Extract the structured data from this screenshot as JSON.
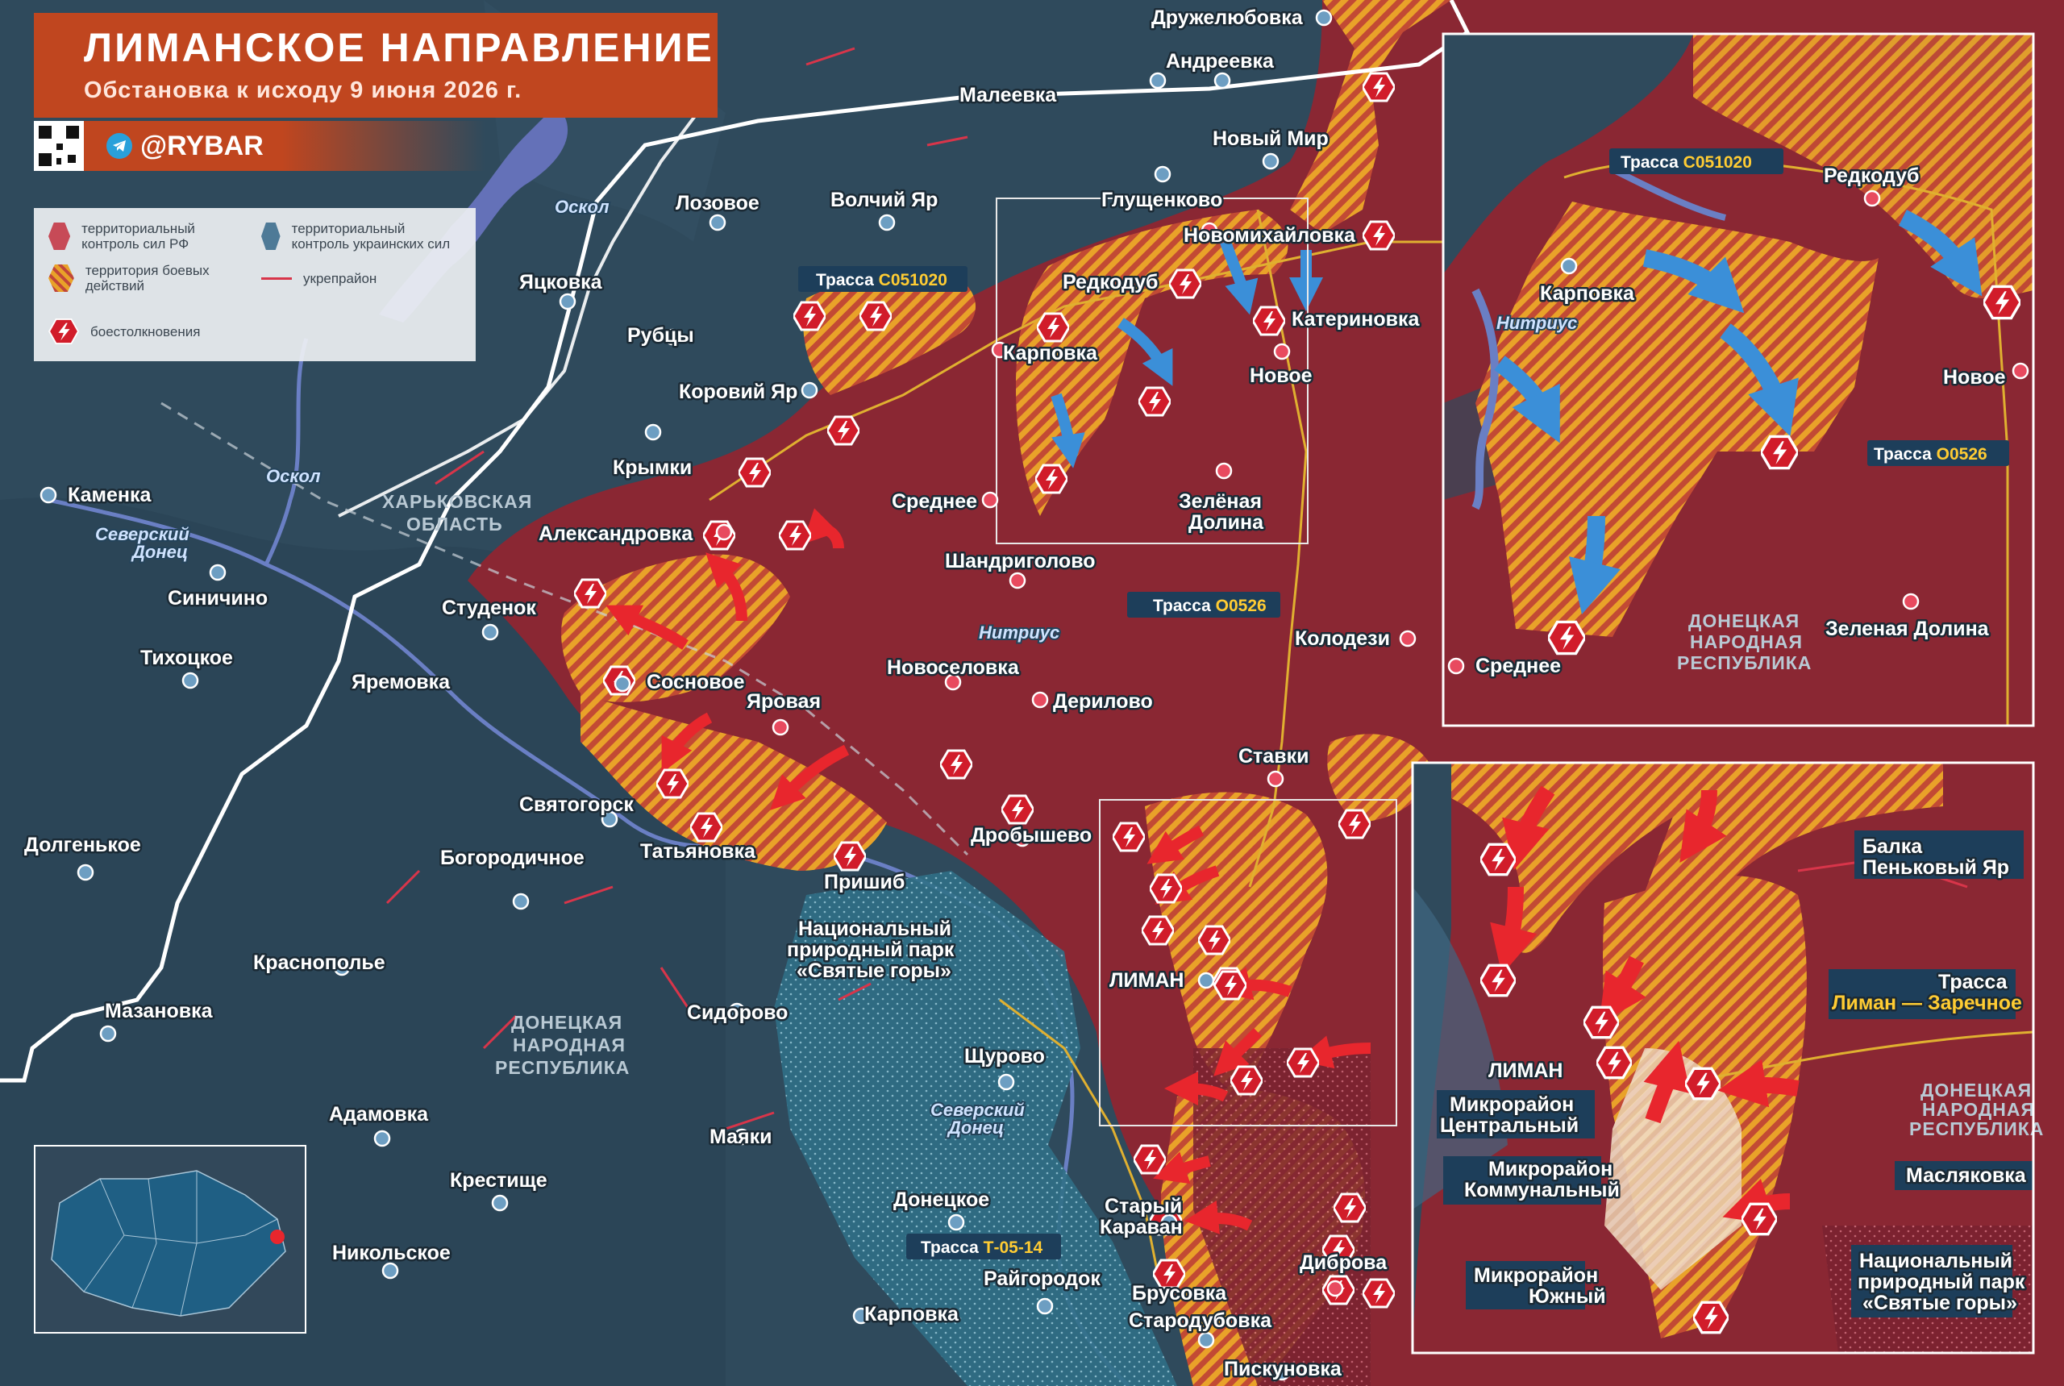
{
  "header": {
    "title": "ЛИМАНСКОЕ НАПРАВЛЕНИЕ",
    "subtitle": "Обстановка к исходу 9 июня 2026 г."
  },
  "brand": {
    "handle": "@RYBAR",
    "icon": "telegram-icon"
  },
  "legend": {
    "ru_control": "территориальный контроль сил РФ",
    "ua_control": "территориальный контроль украинских сил",
    "fighting": "территория боевых действий",
    "fortified": "укрепрайон",
    "clashes": "боестолкновения"
  },
  "colors": {
    "ru": "#8a2733",
    "ua": "#2e4a5c",
    "fight_orange": "#e9a229",
    "clash": "#d11c2a",
    "header": "#c0461f",
    "road_tag": "#1d3e5a",
    "road_code": "#ffcc33"
  },
  "regions": {
    "kharkiv": [
      "ХАРЬКОВСКАЯ",
      "ОБЛАСТЬ"
    ],
    "dnr": [
      "ДОНЕЦКАЯ",
      "НАРОДНАЯ",
      "РЕСПУБЛИКА"
    ]
  },
  "rivers": {
    "oskol1": "Оскол",
    "oskol2": "Оскол",
    "donets1": [
      "Северский",
      "Донец"
    ],
    "donets2": [
      "Северский",
      "Донец"
    ],
    "nitrius": "Нитриус"
  },
  "roads": {
    "r1": {
      "prefix": "Трасса ",
      "code": "С051020"
    },
    "r2": {
      "prefix": "Трасса ",
      "code": "О0526"
    },
    "r3": {
      "prefix": "Трасса ",
      "code": "Т-05-14"
    }
  },
  "places": {
    "druzhelyubovka": "Дружелюбовка",
    "andreevka": "Андреевка",
    "maleevka": "Малеевка",
    "novy_mir": "Новый Мир",
    "lozovoe": "Лозовое",
    "volchiy_yar": "Волчий Яр",
    "glushchenkovo": "Глущенково",
    "novomikhaylovka": "Новомихайловка",
    "yatskovka": "Яцковка",
    "rubtsy": "Рубцы",
    "redkodub": "Редкодуб",
    "katerinovka": "Катериновка",
    "karpovka": "Карповка",
    "novoe": "Новое",
    "koroviy_yar": "Коровий Яр",
    "krymki": "Крымки",
    "srednee": "Среднее",
    "zelenaya_dolina": [
      "Зелёная",
      "Долина"
    ],
    "kamenka": "Каменка",
    "aleksandrovka": "Александровка",
    "shandrigolovo": "Шандриголово",
    "sinichino": "Синичино",
    "studenok": "Студенок",
    "kolodezi": "Колодези",
    "tikhotskoe": "Тихоцкое",
    "yaremovka": "Яремовка",
    "novoselovka": "Новоселовка",
    "sosnovoe": "Сосновое",
    "yarovaya": "Яровая",
    "derilovo": "Дерилово",
    "stavki": "Ставки",
    "svyatogorsk": "Святогорск",
    "dolgenkoe": "Долгенькое",
    "bogorodichnoe": "Богородичное",
    "tatyanovka": "Татьяновка",
    "drobyshevo": "Дробышево",
    "prishib": "Пришиб",
    "park": [
      "Национальный",
      "природный парк",
      "«Святые горы»"
    ],
    "liman": "ЛИМАН",
    "krasnopolye": "Краснополье",
    "mazanovka": "Мазановка",
    "sidorovo": "Сидорово",
    "shchurovo": "Щурово",
    "adamovka": "Адамовка",
    "mayaki": "Маяки",
    "krestishche": "Крестище",
    "donetskoe": "Донецкое",
    "stary_karavan": [
      "Старый",
      "Караван"
    ],
    "nikolskoe": "Никольское",
    "raygorodok": "Райгородок",
    "brusovka": "Брусовка",
    "dibrova": "Диброва",
    "karpovka2": "Карповка",
    "starodubovka": "Стародубовка",
    "piskunovka": "Пискуновка"
  },
  "inset_top": {
    "road1": {
      "prefix": "Трасса ",
      "code": "С051020"
    },
    "road2": {
      "prefix": "Трасса ",
      "code": "О0526"
    },
    "redkodub": "Редкодуб",
    "karpovka": "Карповка",
    "nitrius": "Нитриус",
    "novoe": "Новое",
    "srednee": "Среднее",
    "zelenaya_dolina": "Зеленая Долина",
    "dnr": [
      "ДОНЕЦКАЯ",
      "НАРОДНАЯ",
      "РЕСПУБЛИКА"
    ]
  },
  "inset_bottom": {
    "balka": [
      "Балка",
      "Пеньковый Яр"
    ],
    "road_title": "Трасса",
    "road_code": "Лиман — Заречное",
    "liman": "ЛИМАН",
    "mkr_central": [
      "Микрорайон",
      "Центральный"
    ],
    "mkr_communal": [
      "Микрорайон",
      "Коммунальный"
    ],
    "mkr_south": [
      "Микрорайон",
      "Южный"
    ],
    "maslyakovka": "Масляковка",
    "park": [
      "Национальный",
      "природный парк",
      "«Святые горы»"
    ],
    "dnr": [
      "ДОНЕЦКАЯ",
      "НАРОДНАЯ",
      "РЕСПУБЛИКА"
    ]
  }
}
